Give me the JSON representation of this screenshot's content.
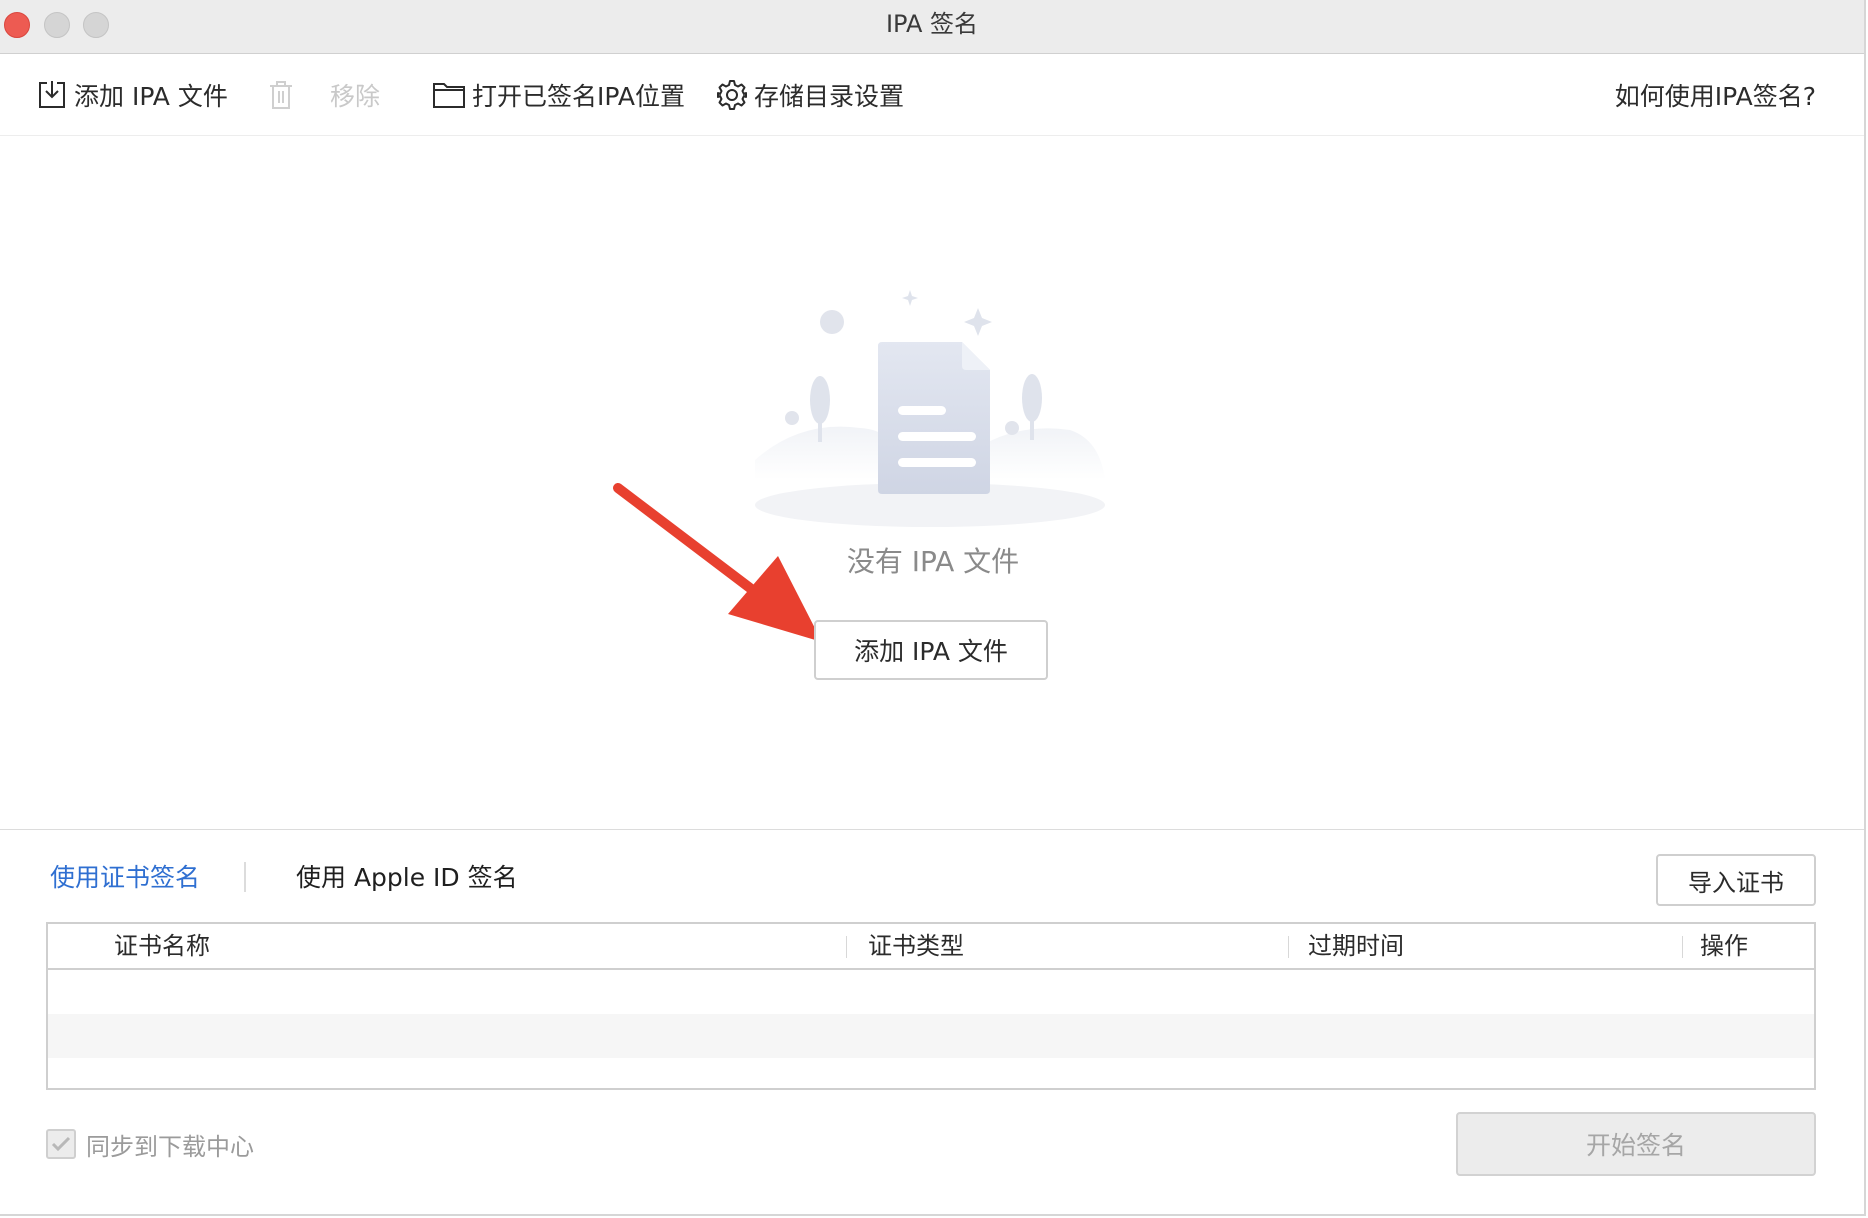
{
  "window": {
    "title": "IPA 签名"
  },
  "toolbar": {
    "add_label": "添加 IPA 文件",
    "remove_label": "移除",
    "open_label": "打开已签名IPA位置",
    "storage_label": "存储目录设置",
    "help_label": "如何使用IPA签名?"
  },
  "empty_state": {
    "message": "没有 IPA 文件",
    "add_button_label": "添加 IPA 文件"
  },
  "signing": {
    "tabs": [
      {
        "label": "使用证书签名",
        "active": true
      },
      {
        "label": "使用 Apple ID 签名",
        "active": false
      }
    ],
    "import_button_label": "导入证书",
    "table": {
      "columns": [
        "证书名称",
        "证书类型",
        "过期时间",
        "操作"
      ],
      "rows": []
    },
    "sync_label": "同步到下载中心",
    "sync_checked": true,
    "start_button_label": "开始签名"
  },
  "colors": {
    "accent": "#2f6fd1",
    "annotation_arrow": "#e8402f",
    "close_button": "#ed5b52"
  }
}
